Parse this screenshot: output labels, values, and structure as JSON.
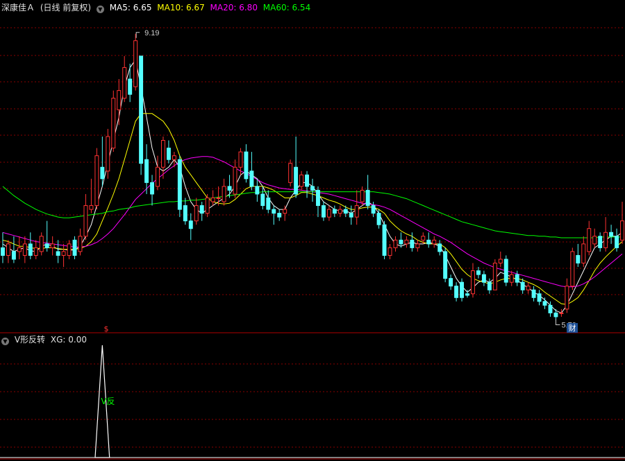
{
  "header": {
    "stock_name": "深康佳Ａ",
    "period_label": "(日线 前复权)",
    "ma_items": [
      {
        "label": "MA5: 6.65",
        "color": "#ffffff"
      },
      {
        "label": "MA10: 6.67",
        "color": "#ffff00"
      },
      {
        "label": "MA20: 6.80",
        "color": "#ff00ff"
      },
      {
        "label": "MA60: 6.54",
        "color": "#00ff00"
      }
    ]
  },
  "sub_header": {
    "indicator_name": "V形反转",
    "value_label": "XG: 0.00"
  },
  "markers": {
    "high_label": "9.19",
    "low_label": "5.70",
    "cai_badge": "财",
    "dollar_mark": "$",
    "signal_label": "V反"
  },
  "colors": {
    "up": "#ff3232",
    "down": "#54ffff",
    "ma5": "#ffffff",
    "ma10": "#ffff00",
    "ma20": "#ff00ff",
    "ma60": "#00ff00",
    "grid": "#8b0000"
  },
  "chart_data": [
    {
      "type": "candlestick",
      "title": "",
      "ylim": [
        5.4,
        9.45
      ],
      "candles": [
        [
          6.4,
          6.3,
          6.6,
          6.2
        ],
        [
          6.3,
          6.45,
          6.5,
          6.2
        ],
        [
          6.35,
          6.25,
          6.55,
          6.2
        ],
        [
          6.35,
          6.4,
          6.55,
          6.25
        ],
        [
          6.3,
          6.45,
          6.55,
          6.2
        ],
        [
          6.45,
          6.3,
          6.6,
          6.25
        ],
        [
          6.3,
          6.4,
          6.5,
          6.25
        ],
        [
          6.35,
          6.55,
          6.6,
          6.3
        ],
        [
          6.45,
          6.4,
          6.75,
          6.35
        ],
        [
          6.4,
          6.45,
          6.55,
          6.3
        ],
        [
          6.35,
          6.3,
          6.5,
          6.2
        ],
        [
          6.3,
          6.35,
          6.45,
          6.15
        ],
        [
          6.3,
          6.45,
          6.5,
          6.25
        ],
        [
          6.5,
          6.3,
          6.55,
          6.25
        ],
        [
          6.35,
          6.55,
          6.65,
          6.3
        ],
        [
          6.55,
          6.95,
          7.1,
          6.5
        ],
        [
          6.9,
          6.95,
          7.3,
          6.85
        ],
        [
          6.95,
          7.6,
          7.7,
          6.9
        ],
        [
          7.45,
          7.3,
          7.85,
          7.2
        ],
        [
          7.4,
          7.85,
          7.95,
          7.3
        ],
        [
          7.7,
          8.35,
          8.45,
          7.65
        ],
        [
          8.2,
          8.45,
          8.6,
          8.0
        ],
        [
          8.35,
          8.75,
          8.9,
          8.3
        ],
        [
          8.6,
          8.4,
          8.8,
          8.3
        ],
        [
          8.5,
          9.1,
          9.19,
          8.45
        ],
        [
          8.9,
          7.5,
          8.9,
          7.35
        ],
        [
          7.55,
          7.25,
          7.75,
          7.1
        ],
        [
          7.25,
          7.1,
          7.35,
          6.95
        ],
        [
          7.2,
          7.45,
          7.6,
          7.15
        ],
        [
          7.45,
          7.8,
          7.85,
          7.3
        ],
        [
          7.7,
          7.55,
          7.8,
          7.5
        ],
        [
          7.55,
          7.6,
          7.65,
          7.45
        ],
        [
          7.55,
          6.9,
          7.6,
          6.8
        ],
        [
          6.95,
          6.75,
          7.05,
          6.7
        ],
        [
          6.75,
          6.65,
          6.85,
          6.5
        ],
        [
          6.75,
          6.95,
          7.05,
          6.7
        ],
        [
          6.95,
          6.85,
          7.0,
          6.75
        ],
        [
          6.85,
          7.05,
          7.1,
          6.8
        ],
        [
          7.0,
          7.05,
          7.15,
          6.95
        ],
        [
          7.05,
          7.05,
          7.2,
          6.95
        ],
        [
          7.0,
          7.2,
          7.3,
          6.95
        ],
        [
          7.2,
          7.15,
          7.35,
          7.05
        ],
        [
          7.1,
          7.45,
          7.55,
          7.05
        ],
        [
          7.45,
          7.65,
          7.7,
          7.35
        ],
        [
          7.65,
          7.3,
          7.75,
          7.25
        ],
        [
          7.4,
          7.2,
          7.65,
          7.15
        ],
        [
          7.2,
          7.1,
          7.3,
          7.0
        ],
        [
          7.1,
          6.95,
          7.2,
          6.9
        ],
        [
          7.05,
          6.9,
          7.15,
          6.85
        ],
        [
          6.9,
          6.85,
          6.95,
          6.7
        ],
        [
          6.85,
          6.8,
          6.9,
          6.75
        ],
        [
          6.85,
          6.9,
          6.95,
          6.75
        ],
        [
          7.25,
          7.5,
          7.55,
          7.2
        ],
        [
          7.45,
          7.1,
          7.85,
          7.05
        ],
        [
          7.2,
          7.35,
          7.4,
          7.15
        ],
        [
          7.35,
          7.2,
          7.4,
          7.05
        ],
        [
          7.2,
          7.15,
          7.3,
          7.0
        ],
        [
          7.15,
          6.95,
          7.2,
          6.8
        ],
        [
          6.95,
          6.8,
          7.0,
          6.75
        ],
        [
          6.8,
          6.9,
          6.95,
          6.75
        ],
        [
          6.9,
          6.85,
          6.95,
          6.8
        ],
        [
          6.85,
          6.9,
          6.95,
          6.8
        ],
        [
          6.9,
          6.85,
          6.95,
          6.8
        ],
        [
          6.85,
          6.8,
          6.95,
          6.7
        ],
        [
          6.8,
          6.95,
          7.15,
          6.7
        ],
        [
          7.0,
          7.15,
          7.2,
          6.95
        ],
        [
          7.15,
          6.95,
          7.35,
          6.9
        ],
        [
          6.95,
          6.85,
          7.0,
          6.8
        ],
        [
          6.85,
          6.7,
          6.9,
          6.65
        ],
        [
          6.7,
          6.3,
          6.75,
          6.25
        ],
        [
          6.3,
          6.4,
          6.45,
          6.25
        ],
        [
          6.4,
          6.5,
          6.55,
          6.35
        ],
        [
          6.5,
          6.45,
          6.6,
          6.4
        ],
        [
          6.45,
          6.5,
          6.55,
          6.4
        ],
        [
          6.5,
          6.4,
          6.6,
          6.35
        ],
        [
          6.4,
          6.45,
          6.5,
          6.35
        ],
        [
          6.5,
          6.55,
          6.6,
          6.45
        ],
        [
          6.5,
          6.45,
          6.6,
          6.4
        ],
        [
          6.45,
          6.5,
          6.55,
          6.4
        ],
        [
          6.45,
          6.35,
          6.5,
          6.3
        ],
        [
          6.35,
          6.0,
          6.4,
          5.95
        ],
        [
          6.0,
          5.9,
          6.05,
          5.85
        ],
        [
          5.9,
          5.75,
          5.95,
          5.7
        ],
        [
          5.95,
          5.75,
          6.0,
          5.7
        ],
        [
          5.8,
          5.78,
          5.85,
          5.75
        ],
        [
          5.8,
          6.1,
          6.2,
          5.75
        ],
        [
          6.1,
          6.05,
          6.15,
          6.0
        ],
        [
          6.05,
          5.95,
          6.1,
          5.9
        ],
        [
          5.95,
          5.85,
          6.0,
          5.8
        ],
        [
          5.85,
          6.2,
          6.25,
          5.85
        ],
        [
          6.2,
          6.25,
          6.35,
          6.15
        ],
        [
          6.25,
          5.95,
          6.3,
          5.9
        ],
        [
          5.95,
          6.05,
          6.1,
          5.9
        ],
        [
          6.05,
          5.95,
          6.1,
          5.9
        ],
        [
          5.95,
          5.85,
          6.0,
          5.8
        ],
        [
          5.85,
          5.9,
          5.95,
          5.8
        ],
        [
          5.85,
          5.75,
          5.9,
          5.7
        ],
        [
          5.8,
          5.7,
          5.85,
          5.65
        ],
        [
          5.7,
          5.65,
          5.75,
          5.6
        ],
        [
          5.65,
          5.55,
          5.7,
          5.5
        ],
        [
          5.55,
          5.5,
          5.6,
          5.45
        ],
        [
          5.55,
          5.55,
          5.6,
          5.5
        ],
        [
          5.6,
          5.9,
          6.0,
          5.55
        ],
        [
          5.9,
          6.35,
          6.4,
          5.85
        ],
        [
          6.3,
          6.2,
          6.45,
          6.15
        ],
        [
          6.2,
          6.45,
          6.55,
          6.15
        ],
        [
          6.35,
          6.65,
          6.75,
          6.3
        ],
        [
          6.45,
          6.55,
          6.65,
          6.4
        ],
        [
          6.55,
          6.4,
          6.6,
          6.35
        ],
        [
          6.4,
          6.6,
          6.8,
          6.35
        ],
        [
          6.6,
          6.55,
          6.7,
          6.45
        ],
        [
          6.55,
          6.4,
          6.65,
          6.35
        ],
        [
          6.5,
          6.75,
          7.0,
          6.45
        ]
      ],
      "ma_series": [
        {
          "name": "MA5",
          "values": [
            6.45,
            6.4,
            6.35,
            6.38,
            6.4,
            6.36,
            6.35,
            6.42,
            6.45,
            6.42,
            6.38,
            6.38,
            6.37,
            6.37,
            6.42,
            6.55,
            6.7,
            6.95,
            7.2,
            7.5,
            7.8,
            8.1,
            8.5,
            8.75,
            8.85,
            8.5,
            8.1,
            7.7,
            7.45,
            7.4,
            7.45,
            7.55,
            7.45,
            7.2,
            7.0,
            6.9,
            6.85,
            6.9,
            6.95,
            7.0,
            7.05,
            7.1,
            7.2,
            7.35,
            7.4,
            7.35,
            7.3,
            7.2,
            7.05,
            6.95,
            6.9,
            6.9,
            7.05,
            7.15,
            7.25,
            7.25,
            7.2,
            7.1,
            7.0,
            6.95,
            6.9,
            6.88,
            6.88,
            6.85,
            6.9,
            6.95,
            7.0,
            6.95,
            6.85,
            6.7,
            6.55,
            6.45,
            6.42,
            6.45,
            6.47,
            6.45,
            6.45,
            6.47,
            6.45,
            6.42,
            6.3,
            6.15,
            6.0,
            5.9,
            5.82,
            5.88,
            5.95,
            5.98,
            5.95,
            6.0,
            6.08,
            6.05,
            6.02,
            5.98,
            5.92,
            5.88,
            5.82,
            5.78,
            5.72,
            5.65,
            5.58,
            5.55,
            5.65,
            5.8,
            5.95,
            6.1,
            6.25,
            6.4,
            6.45,
            6.5,
            6.55,
            6.55,
            6.6
          ]
        },
        {
          "name": "MA10",
          "values": [
            6.5,
            6.48,
            6.45,
            6.42,
            6.42,
            6.4,
            6.39,
            6.39,
            6.4,
            6.4,
            6.39,
            6.38,
            6.38,
            6.38,
            6.39,
            6.42,
            6.48,
            6.58,
            6.75,
            6.92,
            7.1,
            7.3,
            7.55,
            7.8,
            8.05,
            8.15,
            8.15,
            8.15,
            8.1,
            8.05,
            7.95,
            7.8,
            7.6,
            7.45,
            7.35,
            7.25,
            7.15,
            7.05,
            7.0,
            6.98,
            6.97,
            6.98,
            7.03,
            7.1,
            7.17,
            7.2,
            7.2,
            7.2,
            7.18,
            7.15,
            7.1,
            7.05,
            7.05,
            7.08,
            7.12,
            7.12,
            7.1,
            7.08,
            7.05,
            7.02,
            7.0,
            6.97,
            6.93,
            6.9,
            6.9,
            6.92,
            6.93,
            6.93,
            6.9,
            6.85,
            6.75,
            6.68,
            6.62,
            6.58,
            6.55,
            6.5,
            6.47,
            6.45,
            6.45,
            6.45,
            6.4,
            6.32,
            6.22,
            6.12,
            6.05,
            6.0,
            5.97,
            5.95,
            5.93,
            5.95,
            5.98,
            6.0,
            6.0,
            6.0,
            5.98,
            5.95,
            5.92,
            5.88,
            5.82,
            5.77,
            5.72,
            5.67,
            5.66,
            5.7,
            5.75,
            5.85,
            5.97,
            6.1,
            6.2,
            6.28,
            6.35,
            6.42,
            6.48
          ]
        },
        {
          "name": "MA20",
          "values": [
            6.6,
            6.58,
            6.56,
            6.54,
            6.52,
            6.5,
            6.48,
            6.47,
            6.46,
            6.45,
            6.44,
            6.43,
            6.42,
            6.41,
            6.41,
            6.42,
            6.44,
            6.47,
            6.52,
            6.58,
            6.65,
            6.74,
            6.83,
            6.93,
            7.03,
            7.1,
            7.17,
            7.24,
            7.3,
            7.36,
            7.42,
            7.47,
            7.52,
            7.55,
            7.57,
            7.58,
            7.59,
            7.59,
            7.58,
            7.55,
            7.52,
            7.48,
            7.44,
            7.4,
            7.37,
            7.33,
            7.29,
            7.25,
            7.22,
            7.2,
            7.18,
            7.17,
            7.16,
            7.16,
            7.15,
            7.14,
            7.13,
            7.12,
            7.11,
            7.1,
            7.08,
            7.06,
            7.04,
            7.02,
            7.0,
            6.98,
            6.97,
            6.96,
            6.95,
            6.93,
            6.9,
            6.86,
            6.82,
            6.78,
            6.74,
            6.7,
            6.66,
            6.62,
            6.58,
            6.55,
            6.51,
            6.47,
            6.42,
            6.37,
            6.32,
            6.28,
            6.24,
            6.2,
            6.17,
            6.14,
            6.12,
            6.1,
            6.08,
            6.06,
            6.04,
            6.02,
            6.0,
            5.98,
            5.96,
            5.94,
            5.92,
            5.9,
            5.89,
            5.89,
            5.9,
            5.93,
            5.97,
            6.02,
            6.08,
            6.14,
            6.2,
            6.26,
            6.32
          ]
        },
        {
          "name": "MA60",
          "values": [
            7.2,
            7.14,
            7.08,
            7.03,
            6.98,
            6.94,
            6.9,
            6.87,
            6.84,
            6.82,
            6.8,
            6.79,
            6.79,
            6.8,
            6.81,
            6.82,
            6.83,
            6.84,
            6.85,
            6.87,
            6.88,
            6.9,
            6.91,
            6.92,
            6.94,
            6.95,
            6.96,
            6.97,
            6.98,
            6.99,
            7.0,
            7.0,
            7.01,
            7.01,
            7.02,
            7.02,
            7.03,
            7.04,
            7.05,
            7.06,
            7.07,
            7.08,
            7.09,
            7.1,
            7.11,
            7.12,
            7.12,
            7.13,
            7.13,
            7.13,
            7.13,
            7.13,
            7.13,
            7.13,
            7.13,
            7.13,
            7.13,
            7.13,
            7.13,
            7.13,
            7.13,
            7.13,
            7.13,
            7.13,
            7.13,
            7.13,
            7.13,
            7.13,
            7.12,
            7.11,
            7.1,
            7.08,
            7.06,
            7.04,
            7.01,
            6.98,
            6.95,
            6.92,
            6.89,
            6.86,
            6.83,
            6.8,
            6.77,
            6.74,
            6.72,
            6.7,
            6.68,
            6.66,
            6.64,
            6.62,
            6.61,
            6.6,
            6.59,
            6.58,
            6.57,
            6.56,
            6.56,
            6.55,
            6.55,
            6.54,
            6.54,
            6.53,
            6.53,
            6.53,
            6.53,
            6.53,
            6.53,
            6.53,
            6.54,
            6.54,
            6.54,
            6.54,
            6.54
          ]
        }
      ]
    },
    {
      "type": "line",
      "title": "",
      "ylim": [
        0,
        1
      ],
      "values": [
        0,
        0,
        0,
        0,
        0,
        0,
        0,
        0,
        0,
        0,
        0,
        0,
        0,
        0,
        0,
        0,
        0,
        0,
        1,
        0,
        0,
        0,
        0,
        0,
        0,
        0,
        0,
        0,
        0,
        0,
        0,
        0,
        0,
        0,
        0,
        0,
        0,
        0,
        0,
        0,
        0,
        0,
        0,
        0,
        0,
        0,
        0,
        0,
        0,
        0,
        0,
        0,
        0,
        0,
        0,
        0,
        0,
        0,
        0,
        0,
        0,
        0,
        0,
        0,
        0,
        0,
        0,
        0,
        0,
        0,
        0,
        0,
        0,
        0,
        0,
        0,
        0,
        0,
        0,
        0,
        0,
        0,
        0,
        0,
        0,
        0,
        0,
        0,
        0,
        0,
        0,
        0,
        0,
        0,
        0,
        0,
        0,
        0,
        0,
        0,
        0,
        0,
        0,
        0,
        0,
        0,
        0,
        0,
        0,
        0,
        0,
        0,
        0
      ]
    }
  ]
}
